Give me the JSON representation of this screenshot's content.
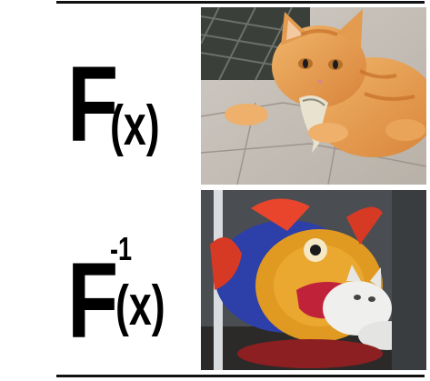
{
  "labels": {
    "top_F": "F",
    "top_arg": "(x)",
    "bottom_F": "F",
    "bottom_exp": "-1",
    "bottom_arg": "(x)"
  },
  "images": {
    "top": "orange-cat-holding-fish-in-mouth",
    "bottom": "fish-plush-toy-holding-white-cat-in-mouth"
  }
}
